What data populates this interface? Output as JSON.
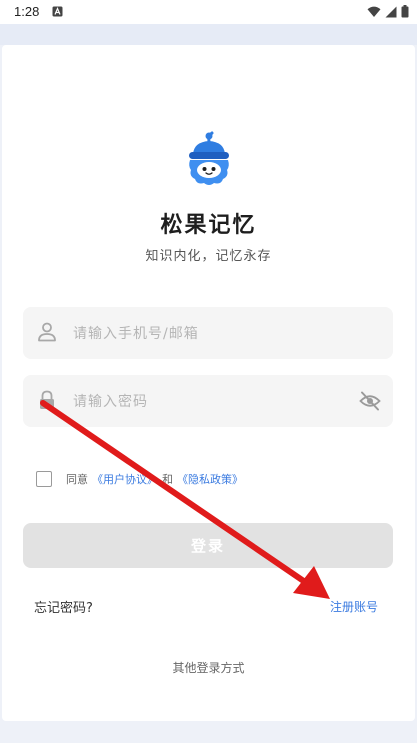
{
  "status_bar": {
    "time": "1:28",
    "icons": [
      "notification-a-icon",
      "wifi-icon",
      "signal-icon",
      "battery-icon"
    ]
  },
  "app": {
    "title": "松果记忆",
    "slogan": "知识内化，记忆永存",
    "logo_icon": "pinecone-mascot-icon"
  },
  "form": {
    "account_placeholder": "请输入手机号/邮箱",
    "password_placeholder": "请输入密码",
    "account_icon": "user-icon",
    "password_icon": "lock-icon",
    "visibility_icon": "eye-off-icon"
  },
  "agreement": {
    "prefix": "同意",
    "user_agreement": "《用户协议》",
    "and": "和",
    "privacy_policy": "《隐私政策》",
    "checked": false
  },
  "actions": {
    "login_label": "登录",
    "forgot_password": "忘记密码?",
    "register": "注册账号",
    "other_login": "其他登录方式"
  },
  "colors": {
    "accent": "#3b7be0",
    "button_disabled": "#e2e2e2",
    "input_bg": "#f5f5f5",
    "logo_blue": "#2f7de1",
    "annotation_arrow": "#e01b1b"
  }
}
